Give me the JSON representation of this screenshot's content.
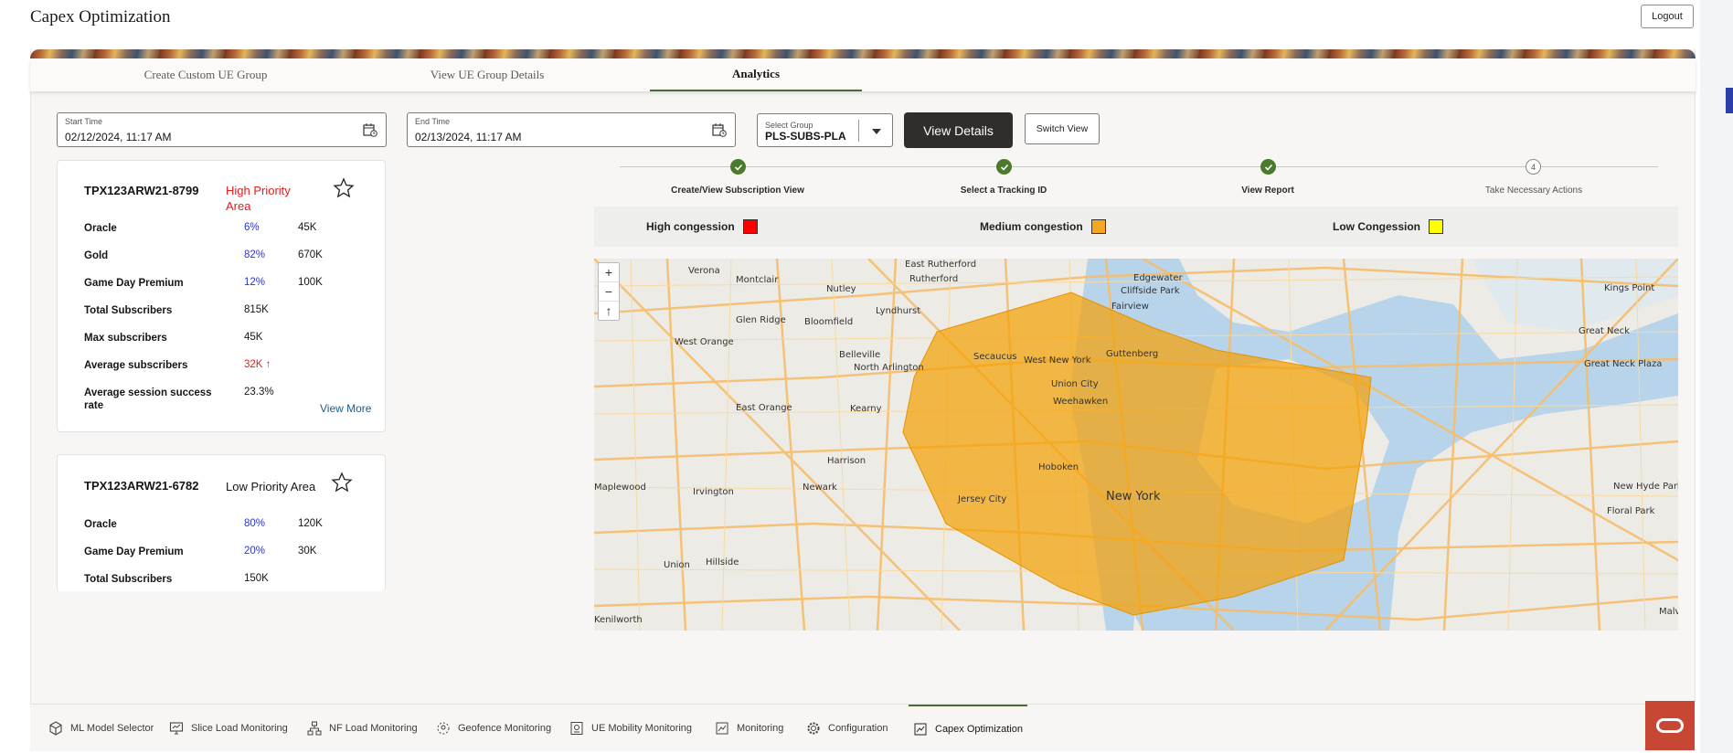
{
  "app": {
    "title": "Capex Optimization",
    "logout_label": "Logout"
  },
  "tabs": [
    {
      "label": "Create Custom UE Group"
    },
    {
      "label": "View UE Group Details"
    },
    {
      "label": "Analytics"
    }
  ],
  "filters": {
    "start_time": {
      "label": "Start Time",
      "value": "02/12/2024, 11:17 AM"
    },
    "end_time": {
      "label": "End Time",
      "value": "02/13/2024, 11:17 AM"
    },
    "group": {
      "label": "Select Group",
      "value": "PLS-SUBS-PLA"
    },
    "view_details_label": "View Details",
    "switch_view_label": "Switch View"
  },
  "cards": [
    {
      "id": "TPX123ARW21-8799",
      "area": "High Priority Area",
      "area_color": "#e02020",
      "rows": [
        {
          "label": "Oracle",
          "pct": "6%",
          "value": "45K"
        },
        {
          "label": "Gold",
          "pct": "82%",
          "value": "670K"
        },
        {
          "label": "Game Day Premium",
          "pct": "12%",
          "value": "100K"
        }
      ],
      "stats": [
        {
          "label": "Total Subscribers",
          "value": "815K"
        },
        {
          "label": "Max subscribers",
          "value": "45K"
        },
        {
          "label": "Average subscribers",
          "value": "32K ↑"
        },
        {
          "label": "Average session success rate",
          "value": "23.3%"
        }
      ],
      "view_more_label": "View More"
    },
    {
      "id": "TPX123ARW21-6782",
      "area": "Low Priority Area",
      "area_color": "#161513",
      "rows": [
        {
          "label": "Oracle",
          "pct": "80%",
          "value": "120K"
        },
        {
          "label": "Game Day Premium",
          "pct": "20%",
          "value": "30K"
        }
      ],
      "stats": [
        {
          "label": "Total Subscribers",
          "value": "150K"
        }
      ]
    }
  ],
  "stepper": {
    "steps": [
      {
        "label": "Create/View Subscription View",
        "status": "done"
      },
      {
        "label": "Select a Tracking ID",
        "status": "done"
      },
      {
        "label": "View Report",
        "status": "done"
      },
      {
        "label": "Take Necessary Actions",
        "status": "pending",
        "number": "4"
      }
    ]
  },
  "legend": [
    {
      "label": "High congession",
      "color": "#ff0000"
    },
    {
      "label": "Medium congestion",
      "color": "#f5a623"
    },
    {
      "label": "Low Congession",
      "color": "#ffff00"
    }
  ],
  "map": {
    "zoom_in": "+",
    "zoom_out": "−",
    "reset": "↑",
    "places": [
      "East Rutherford",
      "Edgewater",
      "Verona",
      "Montclair",
      "Nutley",
      "Rutherford",
      "Cliffside Park",
      "Fairview",
      "Kings Point",
      "Lyndhurst",
      "Glen Ridge",
      "Bloomfield",
      "West Orange",
      "Great Neck",
      "Secaucus",
      "West New York",
      "Guttenberg",
      "Great Neck Plaza",
      "Belleville",
      "North Arlington",
      "Union City",
      "Weehawken",
      "Kearny",
      "East Orange",
      "Harrison",
      "Hoboken",
      "New York",
      "Newark",
      "Jersey City",
      "Maplewood",
      "Irvington",
      "New Hyde Park",
      "Floral Park",
      "Hillside",
      "Union",
      "Kenilworth",
      "Malve"
    ],
    "highlight_level": "medium"
  },
  "bottom_nav": [
    {
      "label": "ML Model Selector",
      "icon": "cube-icon"
    },
    {
      "label": "Slice Load Monitoring",
      "icon": "monitor-icon"
    },
    {
      "label": "NF Load Monitoring",
      "icon": "network-icon"
    },
    {
      "label": "Geofence Monitoring",
      "icon": "geofence-icon"
    },
    {
      "label": "UE Mobility Monitoring",
      "icon": "mobility-icon"
    },
    {
      "label": "Monitoring",
      "icon": "chart-icon"
    },
    {
      "label": "Configuration",
      "icon": "gear-icon"
    },
    {
      "label": "Capex Optimization",
      "icon": "capex-icon"
    }
  ]
}
